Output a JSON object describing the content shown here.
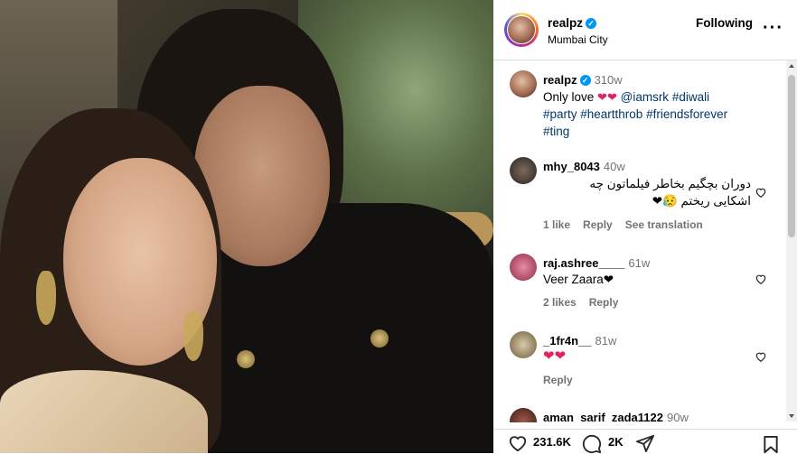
{
  "post": {
    "username": "realpz",
    "location": "Mumbai City",
    "follow_state": "Following"
  },
  "caption": {
    "username": "realpz",
    "time": "310w",
    "line1_text": "Only love",
    "hearts": "❤❤",
    "tags_line1": "@iamsrk #diwali",
    "tags_line2": "#party #heartthrob #friendsforever",
    "tags_line3": "#ting"
  },
  "comments": [
    {
      "username": "mhy_8043",
      "time": "40w",
      "line1": "دوران بچگیم بخاطر فیلماتون چه",
      "line2": "اشکایی ریختم 😥❤",
      "likes": "1 like",
      "reply": "Reply",
      "translate": "See translation"
    },
    {
      "username": "raj.ashree____",
      "time": "61w",
      "text": "Veer Zaara❤",
      "likes": "2 likes",
      "reply": "Reply"
    },
    {
      "username": "_1fr4n__",
      "time": "81w",
      "text": "❤❤",
      "reply": "Reply"
    },
    {
      "username": "aman_sarif_zada1122",
      "time": "90w"
    }
  ],
  "actions": {
    "likes_count": "231.6K",
    "comments_count": "2K"
  },
  "colors": {
    "link": "#00376b",
    "verified": "#0095f6",
    "heart": "#e0245e",
    "muted": "#737373"
  }
}
